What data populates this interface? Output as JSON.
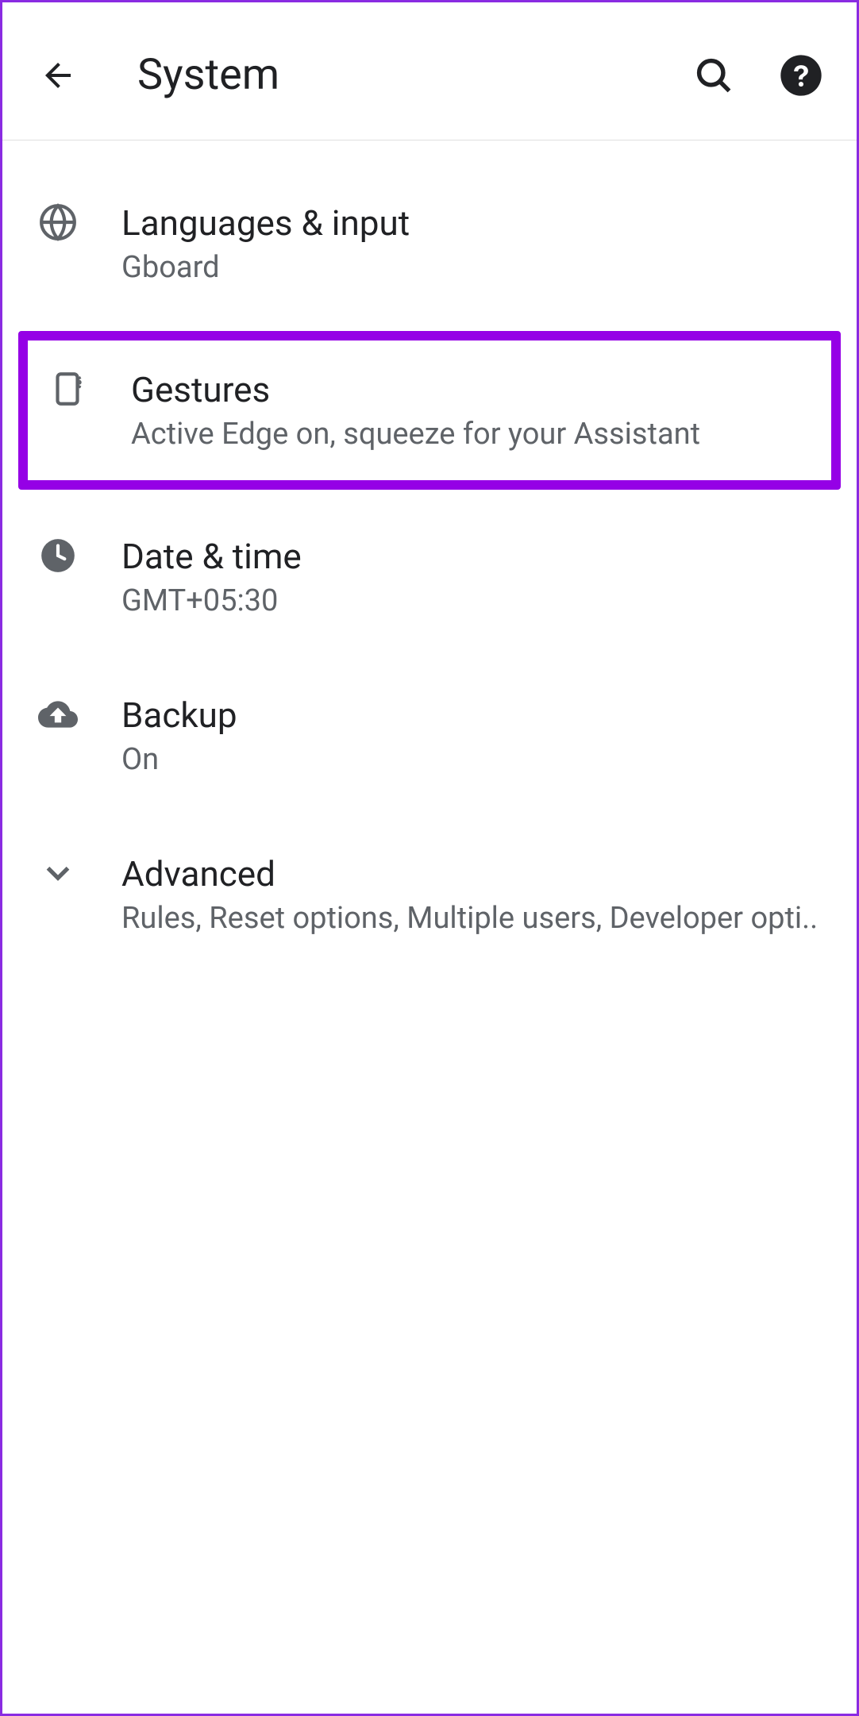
{
  "header": {
    "title": "System"
  },
  "settings": [
    {
      "title": "Languages & input",
      "subtitle": "Gboard"
    },
    {
      "title": "Gestures",
      "subtitle": "Active Edge on, squeeze for your Assistant"
    },
    {
      "title": "Date & time",
      "subtitle": "GMT+05:30"
    },
    {
      "title": "Backup",
      "subtitle": "On"
    },
    {
      "title": "Advanced",
      "subtitle": "Rules, Reset options, Multiple users, Developer opti.."
    }
  ]
}
